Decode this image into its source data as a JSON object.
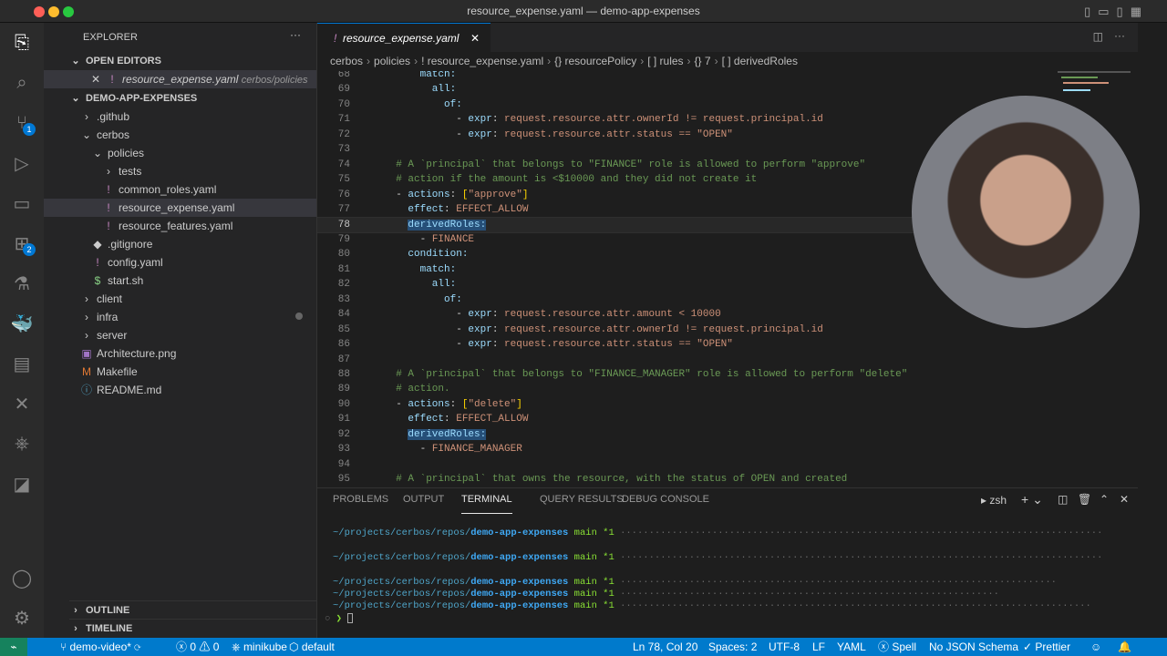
{
  "window": {
    "title": "resource_expense.yaml — demo-app-expenses"
  },
  "sidebar": {
    "title": "EXPLORER",
    "open_editors": "OPEN EDITORS",
    "open_file": {
      "name": "resource_expense.yaml",
      "path": "cerbos/policies"
    },
    "project": "DEMO-APP-EXPENSES",
    "items": [
      {
        "label": ".github",
        "icon": "chevron-right",
        "depth": 1
      },
      {
        "label": "cerbos",
        "icon": "chevron-down",
        "depth": 1
      },
      {
        "label": "policies",
        "icon": "chevron-down",
        "depth": 2
      },
      {
        "label": "tests",
        "icon": "chevron-right",
        "depth": 3
      },
      {
        "label": "common_roles.yaml",
        "icon": "!",
        "depth": 3
      },
      {
        "label": "resource_expense.yaml",
        "icon": "!",
        "depth": 3,
        "selected": true
      },
      {
        "label": "resource_features.yaml",
        "icon": "!",
        "depth": 3
      },
      {
        "label": ".gitignore",
        "icon": "◆",
        "depth": 2
      },
      {
        "label": "config.yaml",
        "icon": "!",
        "depth": 2
      },
      {
        "label": "start.sh",
        "icon": "$",
        "depth": 2
      },
      {
        "label": "client",
        "icon": "chevron-right",
        "depth": 1
      },
      {
        "label": "infra",
        "icon": "chevron-right",
        "depth": 1
      },
      {
        "label": "server",
        "icon": "chevron-right",
        "depth": 1
      },
      {
        "label": "Architecture.png",
        "icon": "▣",
        "depth": 1
      },
      {
        "label": "Makefile",
        "icon": "M",
        "depth": 1
      },
      {
        "label": "README.md",
        "icon": "ⓘ",
        "depth": 1
      }
    ],
    "outline": "OUTLINE",
    "timeline": "TIMELINE"
  },
  "activity": {
    "scm_badge": "1",
    "ext_badge": "2"
  },
  "editor": {
    "tab": "resource_expense.yaml",
    "breadcrumbs": [
      "cerbos",
      "policies",
      "! resource_expense.yaml",
      "{} resourcePolicy",
      "[ ] rules",
      "{} 7",
      "[ ] derivedRoles"
    ],
    "current_line": 78,
    "lines": [
      {
        "n": 68,
        "segs": [
          [
            "k",
            "      match:"
          ]
        ]
      },
      {
        "n": 69,
        "segs": [
          [
            "k",
            "        all:"
          ]
        ]
      },
      {
        "n": 70,
        "segs": [
          [
            "k",
            "          of:"
          ]
        ]
      },
      {
        "n": 71,
        "segs": [
          [
            "p",
            "            - "
          ],
          [
            "k",
            "expr"
          ],
          [
            "p",
            ": "
          ],
          [
            "s",
            "request.resource.attr.ownerId != request.principal.id"
          ]
        ]
      },
      {
        "n": 72,
        "segs": [
          [
            "p",
            "            - "
          ],
          [
            "k",
            "expr"
          ],
          [
            "p",
            ": "
          ],
          [
            "s",
            "request.resource.attr.status == \"OPEN\""
          ]
        ]
      },
      {
        "n": 73,
        "segs": []
      },
      {
        "n": 74,
        "segs": [
          [
            "c",
            "  # A `principal` that belongs to \"FINANCE\" role is allowed to perform \"approve\""
          ]
        ]
      },
      {
        "n": 75,
        "segs": [
          [
            "c",
            "  # action if the amount is <$10000 and they did not create it"
          ]
        ]
      },
      {
        "n": 76,
        "segs": [
          [
            "p",
            "  - "
          ],
          [
            "k",
            "actions"
          ],
          [
            "p",
            ": "
          ],
          [
            "y",
            "["
          ],
          [
            "s",
            "\"approve\""
          ],
          [
            "y",
            "]"
          ]
        ]
      },
      {
        "n": 77,
        "segs": [
          [
            "k",
            "    effect"
          ],
          [
            "p",
            ": "
          ],
          [
            "s",
            "EFFECT_ALLOW"
          ]
        ]
      },
      {
        "n": 78,
        "segs": [
          [
            "p",
            "    "
          ],
          [
            "k hl",
            "derivedRoles:"
          ]
        ]
      },
      {
        "n": 79,
        "segs": [
          [
            "p",
            "      - "
          ],
          [
            "s",
            "FINANCE"
          ]
        ]
      },
      {
        "n": 80,
        "segs": [
          [
            "k",
            "    condition:"
          ]
        ]
      },
      {
        "n": 81,
        "segs": [
          [
            "k",
            "      match:"
          ]
        ]
      },
      {
        "n": 82,
        "segs": [
          [
            "k",
            "        all:"
          ]
        ]
      },
      {
        "n": 83,
        "segs": [
          [
            "k",
            "          of:"
          ]
        ]
      },
      {
        "n": 84,
        "segs": [
          [
            "p",
            "            - "
          ],
          [
            "k",
            "expr"
          ],
          [
            "p",
            ": "
          ],
          [
            "s",
            "request.resource.attr.amount < 10000"
          ]
        ]
      },
      {
        "n": 85,
        "segs": [
          [
            "p",
            "            - "
          ],
          [
            "k",
            "expr"
          ],
          [
            "p",
            ": "
          ],
          [
            "s",
            "request.resource.attr.ownerId != request.principal.id"
          ]
        ]
      },
      {
        "n": 86,
        "segs": [
          [
            "p",
            "            - "
          ],
          [
            "k",
            "expr"
          ],
          [
            "p",
            ": "
          ],
          [
            "s",
            "request.resource.attr.status == \"OPEN\""
          ]
        ]
      },
      {
        "n": 87,
        "segs": []
      },
      {
        "n": 88,
        "segs": [
          [
            "c",
            "  # A `principal` that belongs to \"FINANCE_MANAGER\" role is allowed to perform \"delete\""
          ]
        ]
      },
      {
        "n": 89,
        "segs": [
          [
            "c",
            "  # action."
          ]
        ]
      },
      {
        "n": 90,
        "segs": [
          [
            "p",
            "  - "
          ],
          [
            "k",
            "actions"
          ],
          [
            "p",
            ": "
          ],
          [
            "y",
            "["
          ],
          [
            "s",
            "\"delete\""
          ],
          [
            "y",
            "]"
          ]
        ]
      },
      {
        "n": 91,
        "segs": [
          [
            "k",
            "    effect"
          ],
          [
            "p",
            ": "
          ],
          [
            "s",
            "EFFECT_ALLOW"
          ]
        ]
      },
      {
        "n": 92,
        "segs": [
          [
            "p",
            "    "
          ],
          [
            "k hl",
            "derivedRoles:"
          ]
        ]
      },
      {
        "n": 93,
        "segs": [
          [
            "p",
            "      - "
          ],
          [
            "s",
            "FINANCE_MANAGER"
          ]
        ]
      },
      {
        "n": 94,
        "segs": []
      },
      {
        "n": 95,
        "segs": [
          [
            "c",
            "  # A `principal` that owns the resource, with the status of OPEN and created"
          ]
        ]
      }
    ]
  },
  "panel": {
    "tabs": [
      "PROBLEMS",
      "OUTPUT",
      "TERMINAL",
      "QUERY RESULTS",
      "DEBUG CONSOLE"
    ],
    "active_tab": "TERMINAL",
    "shell": "zsh",
    "terminal": [
      {
        "path": "~/projects/cerbos/repos/",
        "repo": "demo-app-expenses",
        "branch": "main *1"
      },
      {
        "path": "~/projects/cerbos/repos/",
        "repo": "demo-app-expenses",
        "branch": "main *1"
      },
      {
        "path": "~/projects/cerbos/repos/",
        "repo": "demo-app-expenses",
        "branch": "main *1"
      },
      {
        "path": "~/projects/cerbos/repos/",
        "repo": "demo-app-expenses",
        "branch": "main *1"
      },
      {
        "path": "~/projects/cerbos/repos/",
        "repo": "demo-app-expenses",
        "branch": "main *1"
      }
    ],
    "prompt": "❯"
  },
  "statusbar": {
    "branch": "demo-video*",
    "errors": "0",
    "warnings": "0",
    "context": "minikube",
    "namespace": "default",
    "position": "Ln 78, Col 20",
    "spaces": "Spaces: 2",
    "encoding": "UTF-8",
    "eol": "LF",
    "language": "YAML",
    "spell": "Spell",
    "schema": "No JSON Schema",
    "prettier": "Prettier"
  }
}
